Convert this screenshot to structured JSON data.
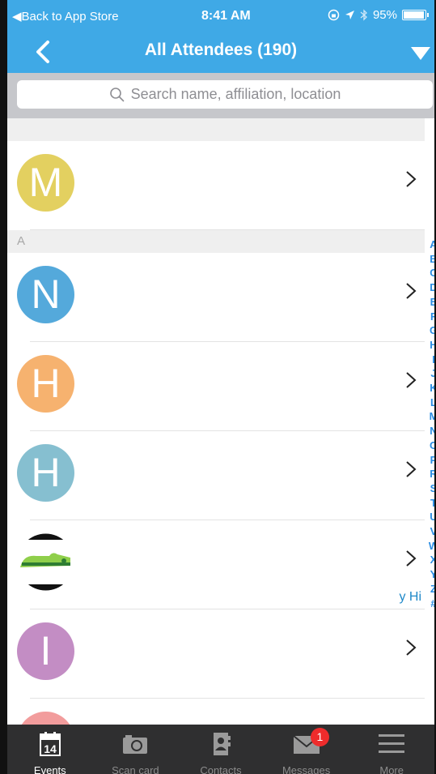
{
  "status": {
    "back_label": "◀︎Back to App Store",
    "time": "8:41 AM",
    "battery": "95%",
    "battery_level": 0.95
  },
  "nav": {
    "title": "All Attendees (190)"
  },
  "search": {
    "placeholder": "Search name, affiliation, location"
  },
  "sections": [
    {
      "header": "",
      "rows": [
        {
          "initial": "M",
          "color": "#e3d060"
        }
      ]
    },
    {
      "header": "A",
      "rows": [
        {
          "initial": "N",
          "color": "#54a9db"
        },
        {
          "initial": "H",
          "color": "#f6b26f"
        },
        {
          "initial": "H",
          "color": "#86bfd0"
        },
        {
          "initial": "",
          "color": "#ffffff",
          "logo": true,
          "snippet": "y Hi"
        },
        {
          "initial": "I",
          "color": "#c38dc4"
        },
        {
          "initial": "",
          "color": "#f29c9c"
        }
      ]
    }
  ],
  "index": [
    "A",
    "B",
    "C",
    "D",
    "E",
    "F",
    "G",
    "H",
    "I",
    "J",
    "K",
    "L",
    "M",
    "N",
    "O",
    "P",
    "R",
    "S",
    "T",
    "U",
    "V",
    "W",
    "X",
    "Y",
    "Z",
    "#"
  ],
  "tabs": [
    {
      "label": "Events",
      "icon": "calendar-icon",
      "date": "14",
      "active": true
    },
    {
      "label": "Scan card",
      "icon": "camera-icon",
      "active": false
    },
    {
      "label": "Contacts",
      "icon": "contacts-icon",
      "active": false
    },
    {
      "label": "Messages",
      "icon": "mail-icon",
      "active": false,
      "badge": "1"
    },
    {
      "label": "More",
      "icon": "menu-icon",
      "active": false
    }
  ],
  "colors": {
    "accent": "#3fa9e6",
    "tabbar": "#2f2f30",
    "index": "#2a8de3"
  }
}
